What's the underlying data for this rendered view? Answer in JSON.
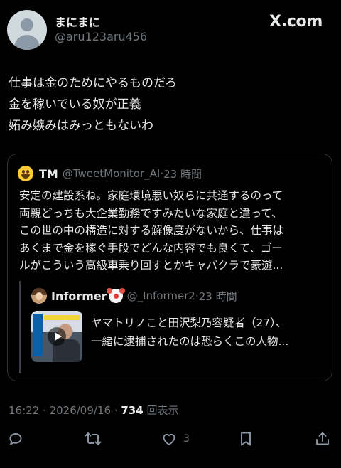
{
  "author": {
    "display_name": "まにまに",
    "handle": "@aru123aru456"
  },
  "brand": "X.com",
  "tweet": {
    "lines": [
      "仕事は金のためにやるものだろ",
      "金を稼いでいる奴が正義",
      "妬み嫉みはみっともないわ"
    ]
  },
  "quoted_tweet": {
    "name": "TM",
    "handle": "@TweetMonitor_AI",
    "time": "23 時間",
    "lines": [
      "安定の建設系ね。家庭環境悪い奴らに共通するのって",
      "両親どっちも大企業勤務ですみたいな家庭と違って、",
      "この世の中の構造に対する解像度がないから、仕事は",
      "あくまで金を稼ぐ手段でどんな内容でも良くて、ゴー",
      "ルがこういう高級車乗り回すとかキャバクラで豪遊..."
    ],
    "nested": {
      "name": "Informer",
      "handle": "@_Informer2",
      "time": "23 時間",
      "lines": [
        "ヤマトリノこと田沢梨乃容疑者（27）、",
        "一緒に逮捕されたのは恐らくこの人物..."
      ]
    }
  },
  "meta": {
    "time": "16:22",
    "date": "2026/09/16",
    "views": "734",
    "views_label": "回表示"
  },
  "actions": {
    "like_count": "3"
  },
  "icons": {
    "reply": "reply-icon",
    "retweet": "retweet-icon",
    "like": "heart-icon",
    "bookmark": "bookmark-icon",
    "share": "share-icon"
  }
}
